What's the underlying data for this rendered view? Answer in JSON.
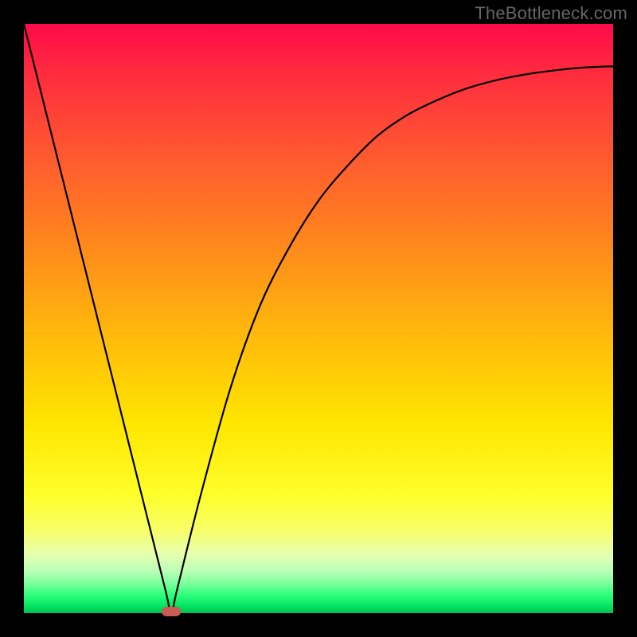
{
  "watermark": "TheBottleneck.com",
  "chart_data": {
    "type": "line",
    "title": "",
    "xlabel": "",
    "ylabel": "",
    "xlim": [
      0,
      100
    ],
    "ylim": [
      0,
      100
    ],
    "grid": false,
    "legend": false,
    "series": [
      {
        "name": "bottleneck-curve",
        "x": [
          0,
          5,
          10,
          15,
          20,
          24,
          25,
          26,
          30,
          35,
          40,
          45,
          50,
          55,
          60,
          65,
          70,
          75,
          80,
          85,
          90,
          95,
          100
        ],
        "values": [
          100,
          80,
          60,
          40,
          20,
          4,
          0,
          4,
          20,
          38,
          52,
          62,
          70,
          76,
          81,
          84.5,
          87,
          89,
          90.4,
          91.4,
          92.1,
          92.6,
          92.8
        ]
      }
    ],
    "marker": {
      "name": "optimal-point",
      "x": 25,
      "y": 0,
      "color": "#cc5a55",
      "shape": "rounded-pill"
    },
    "background_gradient": {
      "top": "#ff0a4a",
      "middle": "#ffe600",
      "bottom": "#00c050"
    }
  }
}
